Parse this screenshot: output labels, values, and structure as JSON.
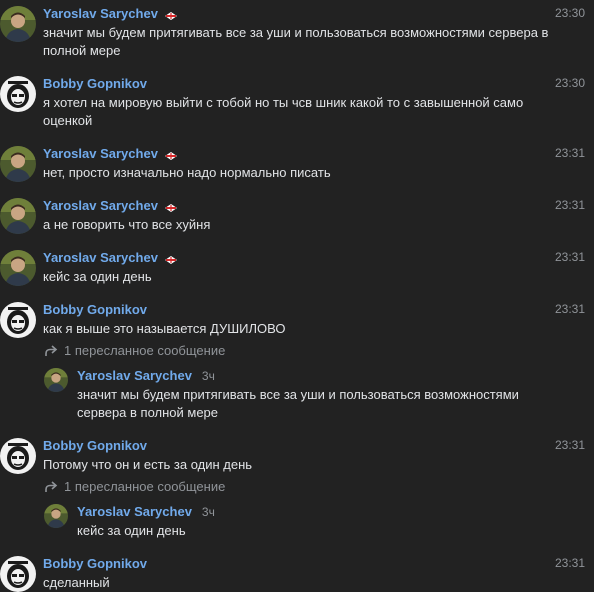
{
  "messages": [
    {
      "author": "Yaroslav Sarychev",
      "time": "23:30",
      "text": "значит мы будем притягивать все за уши и пользоваться возможностями сервера в полной мере",
      "badge": "spartak-badge-icon"
    },
    {
      "author": "Bobby Gopnikov",
      "time": "23:30",
      "text": "я хотел на мировую выйти с тобой но ты чсв шник какой то с завышенной само оценкой"
    },
    {
      "author": "Yaroslav Sarychev",
      "time": "23:31",
      "text": "нет, просто изначально надо нормально писать",
      "badge": "spartak-badge-icon"
    },
    {
      "author": "Yaroslav Sarychev",
      "time": "23:31",
      "text": "а не говорить что все хуйня",
      "badge": "spartak-badge-icon"
    },
    {
      "author": "Yaroslav Sarychev",
      "time": "23:31",
      "text": "кейс за один день",
      "badge": "spartak-badge-icon"
    },
    {
      "author": "Bobby Gopnikov",
      "time": "23:31",
      "text": "как я выше это называется ДУШИЛОВО",
      "forward": {
        "label": "1 пересланное сообщение",
        "author": "Yaroslav Sarychev",
        "ago": "3ч",
        "text": "значит мы будем притягивать все за уши и пользоваться возможностями сервера в полной мере"
      }
    },
    {
      "author": "Bobby Gopnikov",
      "time": "23:31",
      "text": "Потому что он и есть за один день",
      "forward": {
        "label": "1 пересланное сообщение",
        "author": "Yaroslav Sarychev",
        "ago": "3ч",
        "text": "кейс за один день"
      }
    },
    {
      "author": "Bobby Gopnikov",
      "time": "23:31",
      "text": "сделанный"
    }
  ],
  "colors": {
    "background": "#222222",
    "author": "#71aaeb",
    "text": "#e1e3e6",
    "muted": "#909499"
  }
}
